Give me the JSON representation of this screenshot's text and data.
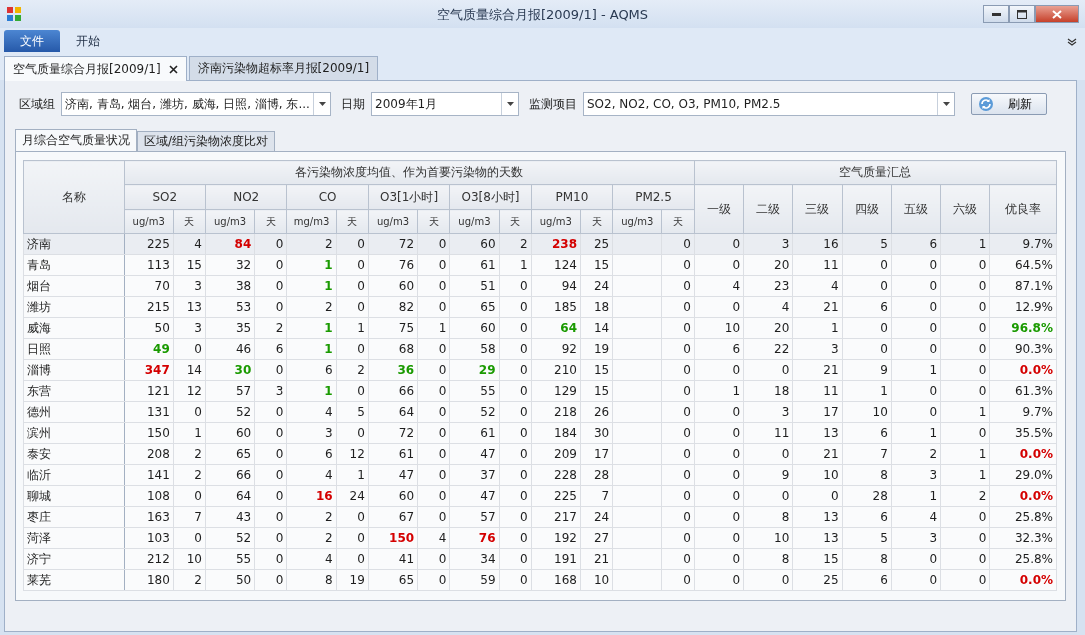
{
  "window": {
    "title": "空气质量综合月报[2009/1] - AQMS"
  },
  "ribbon": {
    "tabs": [
      {
        "label": "文件",
        "selected": true
      },
      {
        "label": "开始",
        "selected": false
      }
    ]
  },
  "document_tabs": [
    {
      "label": "空气质量综合月报[2009/1]",
      "selected": true,
      "closable": true
    },
    {
      "label": "济南污染物超标率月报[2009/1]",
      "selected": false,
      "closable": false
    }
  ],
  "filters": [
    {
      "label": "区域组",
      "value": "济南, 青岛, 烟台, 潍坊, 威海, 日照, 淄博, 东..."
    },
    {
      "label": "日期",
      "value": "2009年1月"
    },
    {
      "label": "监测项目",
      "value": "SO2, NO2, CO, O3, PM10, PM2.5"
    }
  ],
  "refresh_button": "刷新",
  "view_tabs": [
    {
      "label": "月综合空气质量状况",
      "selected": true
    },
    {
      "label": "区域/组污染物浓度比对",
      "selected": false
    }
  ],
  "table": {
    "name_header": "名称",
    "pollutant_group_header": "各污染物浓度均值、作为首要污染物的天数",
    "summary_group_header": "空气质量汇总",
    "pollutants": [
      {
        "name": "SO2",
        "unit": "ug/m3",
        "days_label": "天"
      },
      {
        "name": "NO2",
        "unit": "ug/m3",
        "days_label": "天"
      },
      {
        "name": "CO",
        "unit": "mg/m3",
        "days_label": "天"
      },
      {
        "name": "O3[1小时]",
        "unit": "ug/m3",
        "days_label": "天"
      },
      {
        "name": "O3[8小时]",
        "unit": "ug/m3",
        "days_label": "天"
      },
      {
        "name": "PM10",
        "unit": "ug/m3",
        "days_label": "天"
      },
      {
        "name": "PM2.5",
        "unit": "ug/m3",
        "days_label": "天"
      }
    ],
    "summary_columns": [
      "一级",
      "二级",
      "三级",
      "四级",
      "五级",
      "六级",
      "优良率"
    ],
    "rows": [
      {
        "name": "济南",
        "selected": true,
        "pollutants": [
          [
            "225",
            "4"
          ],
          [
            {
              "text": "84",
              "kind": "worst"
            },
            "0"
          ],
          [
            "2",
            "0"
          ],
          [
            "72",
            "0"
          ],
          [
            "60",
            "2"
          ],
          [
            {
              "text": "238",
              "kind": "worst"
            },
            "25"
          ],
          {
            "days": "0"
          }
        ],
        "summary": [
          "0",
          "3",
          "16",
          "5",
          "6",
          "1",
          "9.7%"
        ]
      },
      {
        "name": "青岛",
        "selected": false,
        "pollutants": [
          [
            "113",
            "15"
          ],
          [
            "32",
            "0"
          ],
          [
            {
              "text": "1",
              "kind": "best"
            },
            "0"
          ],
          [
            "76",
            "0"
          ],
          [
            "61",
            "1"
          ],
          [
            "124",
            "15"
          ],
          {
            "days": "0"
          }
        ],
        "summary": [
          "0",
          "20",
          "11",
          "0",
          "0",
          "0",
          "64.5%"
        ]
      },
      {
        "name": "烟台",
        "selected": false,
        "pollutants": [
          [
            "70",
            "3"
          ],
          [
            "38",
            "0"
          ],
          [
            {
              "text": "1",
              "kind": "best"
            },
            "0"
          ],
          [
            "60",
            "0"
          ],
          [
            "51",
            "0"
          ],
          [
            "94",
            "24"
          ],
          {
            "days": "0"
          }
        ],
        "summary": [
          "4",
          "23",
          "4",
          "0",
          "0",
          "0",
          "87.1%"
        ]
      },
      {
        "name": "潍坊",
        "selected": false,
        "pollutants": [
          [
            "215",
            "13"
          ],
          [
            "53",
            "0"
          ],
          [
            "2",
            "0"
          ],
          [
            "82",
            "0"
          ],
          [
            "65",
            "0"
          ],
          [
            "185",
            "18"
          ],
          {
            "days": "0"
          }
        ],
        "summary": [
          "0",
          "4",
          "21",
          "6",
          "0",
          "0",
          "12.9%"
        ]
      },
      {
        "name": "威海",
        "selected": false,
        "pollutants": [
          [
            "50",
            "3"
          ],
          [
            "35",
            "2"
          ],
          [
            {
              "text": "1",
              "kind": "best"
            },
            "1"
          ],
          [
            "75",
            "1"
          ],
          [
            "60",
            "0"
          ],
          [
            {
              "text": "64",
              "kind": "best"
            },
            "14"
          ],
          {
            "days": "0"
          }
        ],
        "summary": [
          "10",
          "20",
          "1",
          "0",
          "0",
          "0",
          {
            "text": "96.8%",
            "kind": "best"
          }
        ]
      },
      {
        "name": "日照",
        "selected": false,
        "pollutants": [
          [
            {
              "text": "49",
              "kind": "best"
            },
            "0"
          ],
          [
            "46",
            "6"
          ],
          [
            {
              "text": "1",
              "kind": "best"
            },
            "0"
          ],
          [
            "68",
            "0"
          ],
          [
            "58",
            "0"
          ],
          [
            "92",
            "19"
          ],
          {
            "days": "0"
          }
        ],
        "summary": [
          "6",
          "22",
          "3",
          "0",
          "0",
          "0",
          "90.3%"
        ]
      },
      {
        "name": "淄博",
        "selected": false,
        "pollutants": [
          [
            {
              "text": "347",
              "kind": "worst"
            },
            "14"
          ],
          [
            {
              "text": "30",
              "kind": "best"
            },
            "0"
          ],
          [
            "6",
            "2"
          ],
          [
            {
              "text": "36",
              "kind": "best"
            },
            "0"
          ],
          [
            {
              "text": "29",
              "kind": "best"
            },
            "0"
          ],
          [
            "210",
            "15"
          ],
          {
            "days": "0"
          }
        ],
        "summary": [
          "0",
          "0",
          "21",
          "9",
          "1",
          "0",
          {
            "text": "0.0%",
            "kind": "worst"
          }
        ]
      },
      {
        "name": "东营",
        "selected": false,
        "pollutants": [
          [
            "121",
            "12"
          ],
          [
            "57",
            "3"
          ],
          [
            {
              "text": "1",
              "kind": "best"
            },
            "0"
          ],
          [
            "66",
            "0"
          ],
          [
            "55",
            "0"
          ],
          [
            "129",
            "15"
          ],
          {
            "days": "0"
          }
        ],
        "summary": [
          "1",
          "18",
          "11",
          "1",
          "0",
          "0",
          "61.3%"
        ]
      },
      {
        "name": "德州",
        "selected": false,
        "pollutants": [
          [
            "131",
            "0"
          ],
          [
            "52",
            "0"
          ],
          [
            "4",
            "5"
          ],
          [
            "64",
            "0"
          ],
          [
            "52",
            "0"
          ],
          [
            "218",
            "26"
          ],
          {
            "days": "0"
          }
        ],
        "summary": [
          "0",
          "3",
          "17",
          "10",
          "0",
          "1",
          "9.7%"
        ]
      },
      {
        "name": "滨州",
        "selected": false,
        "pollutants": [
          [
            "150",
            "1"
          ],
          [
            "60",
            "0"
          ],
          [
            "3",
            "0"
          ],
          [
            "72",
            "0"
          ],
          [
            "61",
            "0"
          ],
          [
            "184",
            "30"
          ],
          {
            "days": "0"
          }
        ],
        "summary": [
          "0",
          "11",
          "13",
          "6",
          "1",
          "0",
          "35.5%"
        ]
      },
      {
        "name": "泰安",
        "selected": false,
        "pollutants": [
          [
            "208",
            "2"
          ],
          [
            "65",
            "0"
          ],
          [
            "6",
            "12"
          ],
          [
            "61",
            "0"
          ],
          [
            "47",
            "0"
          ],
          [
            "209",
            "17"
          ],
          {
            "days": "0"
          }
        ],
        "summary": [
          "0",
          "0",
          "21",
          "7",
          "2",
          "1",
          {
            "text": "0.0%",
            "kind": "worst"
          }
        ]
      },
      {
        "name": "临沂",
        "selected": false,
        "pollutants": [
          [
            "141",
            "2"
          ],
          [
            "66",
            "0"
          ],
          [
            "4",
            "1"
          ],
          [
            "47",
            "0"
          ],
          [
            "37",
            "0"
          ],
          [
            "228",
            "28"
          ],
          {
            "days": "0"
          }
        ],
        "summary": [
          "0",
          "9",
          "10",
          "8",
          "3",
          "1",
          "29.0%"
        ]
      },
      {
        "name": "聊城",
        "selected": false,
        "pollutants": [
          [
            "108",
            "0"
          ],
          [
            "64",
            "0"
          ],
          [
            {
              "text": "16",
              "kind": "worst"
            },
            "24"
          ],
          [
            "60",
            "0"
          ],
          [
            "47",
            "0"
          ],
          [
            "225",
            "7"
          ],
          {
            "days": "0"
          }
        ],
        "summary": [
          "0",
          "0",
          "0",
          "28",
          "1",
          "2",
          {
            "text": "0.0%",
            "kind": "worst"
          }
        ]
      },
      {
        "name": "枣庄",
        "selected": false,
        "pollutants": [
          [
            "163",
            "7"
          ],
          [
            "43",
            "0"
          ],
          [
            "2",
            "0"
          ],
          [
            "67",
            "0"
          ],
          [
            "57",
            "0"
          ],
          [
            "217",
            "24"
          ],
          {
            "days": "0"
          }
        ],
        "summary": [
          "0",
          "8",
          "13",
          "6",
          "4",
          "0",
          "25.8%"
        ]
      },
      {
        "name": "菏泽",
        "selected": false,
        "pollutants": [
          [
            "103",
            "0"
          ],
          [
            "52",
            "0"
          ],
          [
            "2",
            "0"
          ],
          [
            {
              "text": "150",
              "kind": "worst"
            },
            "4"
          ],
          [
            {
              "text": "76",
              "kind": "worst"
            },
            "0"
          ],
          [
            "192",
            "27"
          ],
          {
            "days": "0"
          }
        ],
        "summary": [
          "0",
          "10",
          "13",
          "5",
          "3",
          "0",
          "32.3%"
        ]
      },
      {
        "name": "济宁",
        "selected": false,
        "pollutants": [
          [
            "212",
            "10"
          ],
          [
            "55",
            "0"
          ],
          [
            "4",
            "0"
          ],
          [
            "41",
            "0"
          ],
          [
            "34",
            "0"
          ],
          [
            "191",
            "21"
          ],
          {
            "days": "0"
          }
        ],
        "summary": [
          "0",
          "8",
          "15",
          "8",
          "0",
          "0",
          "25.8%"
        ]
      },
      {
        "name": "莱芜",
        "selected": false,
        "pollutants": [
          [
            "180",
            "2"
          ],
          [
            "50",
            "0"
          ],
          [
            "8",
            "19"
          ],
          [
            "65",
            "0"
          ],
          [
            "59",
            "0"
          ],
          [
            "168",
            "10"
          ],
          {
            "days": "0"
          }
        ],
        "summary": [
          "0",
          "0",
          "25",
          "6",
          "0",
          "0",
          {
            "text": "0.0%",
            "kind": "worst"
          }
        ]
      }
    ]
  }
}
